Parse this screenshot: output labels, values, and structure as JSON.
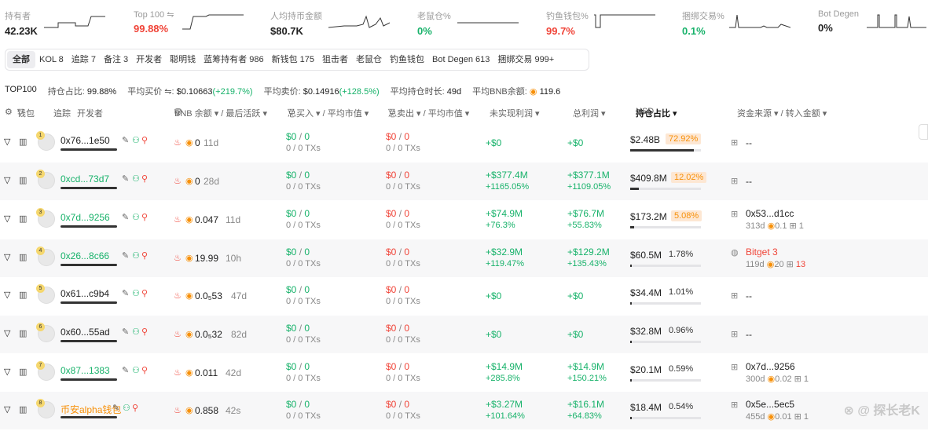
{
  "stats": [
    {
      "label": "持有者",
      "value": "42.23K",
      "color": "#222222"
    },
    {
      "label": "Top 100 ⇋",
      "value": "99.88%",
      "color": "#f04438"
    },
    {
      "label": "人均持币金额",
      "value": "$80.7K",
      "color": "#222222"
    },
    {
      "label": "老鼠仓%",
      "value": "0%",
      "color": "#17b26a"
    },
    {
      "label": "钓鱼钱包%",
      "value": "99.7%",
      "color": "#f04438"
    },
    {
      "label": "捆绑交易%",
      "value": "0.1%",
      "color": "#17b26a"
    },
    {
      "label": "Bot Degen",
      "value": "0%",
      "color": "#222222"
    }
  ],
  "tabs": [
    "全部",
    "KOL 8",
    "追踪 7",
    "备注 3",
    "开发者",
    "聪明钱",
    "蓝筹持有者 986",
    "新钱包 175",
    "狙击者",
    "老鼠仓",
    "钓鱼钱包",
    "Bot Degen 613",
    "捆绑交易 999+"
  ],
  "summary": {
    "top": "TOP100",
    "ratio_label": "持仓占比:",
    "ratio": "99.88%",
    "buy_label": "平均买价 ⇋:",
    "buy": "$0.10663",
    "buy_chg": "(+219.7%)",
    "sell_label": "平均卖价:",
    "sell": "$0.14916",
    "sell_chg": "(+128.5%)",
    "time_label": "平均持仓时长:",
    "time": "49d",
    "bnb_label": "平均BNB余额:",
    "bnb": "119.6"
  },
  "header": {
    "wallet": "钱包",
    "track": "追踪",
    "dev": "开发者",
    "bnb": "BNB 余额 ▾ / 最后活跃 ▾",
    "buy": "总买入 ▾ / 平均市值 ▾",
    "sell": "总卖出 ▾ / 平均市值 ▾",
    "unreal": "未实现利润 ▾",
    "total": "总利润 ▾",
    "hold": "持仓占比 ▾",
    "usd": "USD",
    "source": "资金来源 ▾ / 转入金额 ▾"
  },
  "rows": [
    {
      "rank": "1",
      "addr": "0x76...1e50",
      "addr_color": "default",
      "bnb": "0",
      "active": "11d",
      "buy": "$0",
      "buy_cnt": "0",
      "buy_tx": "0 / 0 TXs",
      "sell": "$0",
      "sell_cnt": "0",
      "sell_tx": "0 / 0 TXs",
      "unreal": "+$0",
      "unreal_pct": "",
      "total": "+$0",
      "total_pct": "",
      "hold_usd": "$2.48B",
      "hold_pct": "72.92%",
      "hold_hi": true,
      "hold_frac": 0.9,
      "src": "--",
      "src_days": "",
      "src_bnb": "",
      "src_cnt": ""
    },
    {
      "rank": "2",
      "addr": "0xcd...73d7",
      "addr_color": "green",
      "bnb": "0",
      "active": "28d",
      "buy": "$0",
      "buy_cnt": "0",
      "buy_tx": "0 / 0 TXs",
      "sell": "$0",
      "sell_cnt": "0",
      "sell_tx": "0 / 0 TXs",
      "unreal": "+$377.4M",
      "unreal_pct": "+1165.05%",
      "total": "+$377.1M",
      "total_pct": "+1109.05%",
      "hold_usd": "$409.8M",
      "hold_pct": "12.02%",
      "hold_hi": true,
      "hold_frac": 0.12,
      "src": "--",
      "src_days": "",
      "src_bnb": "",
      "src_cnt": ""
    },
    {
      "rank": "3",
      "addr": "0x7d...9256",
      "addr_color": "green",
      "bnb": "0.047",
      "active": "11d",
      "buy": "$0",
      "buy_cnt": "0",
      "buy_tx": "0 / 0 TXs",
      "sell": "$0",
      "sell_cnt": "0",
      "sell_tx": "0 / 0 TXs",
      "unreal": "+$74.9M",
      "unreal_pct": "+76.3%",
      "total": "+$76.7M",
      "total_pct": "+55.83%",
      "hold_usd": "$173.2M",
      "hold_pct": "5.08%",
      "hold_hi": true,
      "hold_frac": 0.05,
      "src": "0x53...d1cc",
      "src_days": "313d",
      "src_bnb": "0.1",
      "src_cnt": "1"
    },
    {
      "rank": "4",
      "addr": "0x26...8c66",
      "addr_color": "green",
      "bnb": "19.99",
      "active": "10h",
      "buy": "$0",
      "buy_cnt": "0",
      "buy_tx": "0 / 0 TXs",
      "sell": "$0",
      "sell_cnt": "0",
      "sell_tx": "0 / 0 TXs",
      "unreal": "+$32.9M",
      "unreal_pct": "+119.47%",
      "total": "+$129.2M",
      "total_pct": "+135.43%",
      "hold_usd": "$60.5M",
      "hold_pct": "1.78%",
      "hold_hi": false,
      "hold_frac": 0.02,
      "src": "Bitget 3",
      "src_days": "119d",
      "src_bnb": "20",
      "src_cnt": "13"
    },
    {
      "rank": "5",
      "addr": "0x61...c9b4",
      "addr_color": "default",
      "bnb": "0.0₅53",
      "active": "47d",
      "buy": "$0",
      "buy_cnt": "0",
      "buy_tx": "0 / 0 TXs",
      "sell": "$0",
      "sell_cnt": "0",
      "sell_tx": "0 / 0 TXs",
      "unreal": "+$0",
      "unreal_pct": "",
      "total": "+$0",
      "total_pct": "",
      "hold_usd": "$34.4M",
      "hold_pct": "1.01%",
      "hold_hi": false,
      "hold_frac": 0.01,
      "src": "--",
      "src_days": "",
      "src_bnb": "",
      "src_cnt": ""
    },
    {
      "rank": "6",
      "addr": "0x60...55ad",
      "addr_color": "default",
      "bnb": "0.0₅32",
      "active": "82d",
      "buy": "$0",
      "buy_cnt": "0",
      "buy_tx": "0 / 0 TXs",
      "sell": "$0",
      "sell_cnt": "0",
      "sell_tx": "0 / 0 TXs",
      "unreal": "+$0",
      "unreal_pct": "",
      "total": "+$0",
      "total_pct": "",
      "hold_usd": "$32.8M",
      "hold_pct": "0.96%",
      "hold_hi": false,
      "hold_frac": 0.01,
      "src": "--",
      "src_days": "",
      "src_bnb": "",
      "src_cnt": ""
    },
    {
      "rank": "7",
      "addr": "0x87...1383",
      "addr_color": "green",
      "bnb": "0.011",
      "active": "42d",
      "buy": "$0",
      "buy_cnt": "0",
      "buy_tx": "0 / 0 TXs",
      "sell": "$0",
      "sell_cnt": "0",
      "sell_tx": "0 / 0 TXs",
      "unreal": "+$14.9M",
      "unreal_pct": "+285.8%",
      "total": "+$14.9M",
      "total_pct": "+150.21%",
      "hold_usd": "$20.1M",
      "hold_pct": "0.59%",
      "hold_hi": false,
      "hold_frac": 0.006,
      "src": "0x7d...9256",
      "src_days": "300d",
      "src_bnb": "0.02",
      "src_cnt": "1"
    },
    {
      "rank": "8",
      "addr": "币安alpha钱包",
      "addr_color": "orange",
      "bnb": "0.858",
      "active": "42s",
      "buy": "$0",
      "buy_cnt": "0",
      "buy_tx": "0 / 0 TXs",
      "sell": "$0",
      "sell_cnt": "0",
      "sell_tx": "0 / 0 TXs",
      "unreal": "+$3.27M",
      "unreal_pct": "+101.64%",
      "total": "+$16.1M",
      "total_pct": "+64.83%",
      "hold_usd": "$18.4M",
      "hold_pct": "0.54%",
      "hold_hi": false,
      "hold_frac": 0.005,
      "src": "0x5e...5ec5",
      "src_days": "455d",
      "src_bnb": "0.01",
      "src_cnt": "1"
    }
  ],
  "watermark": "⊗ @ 探长老K"
}
